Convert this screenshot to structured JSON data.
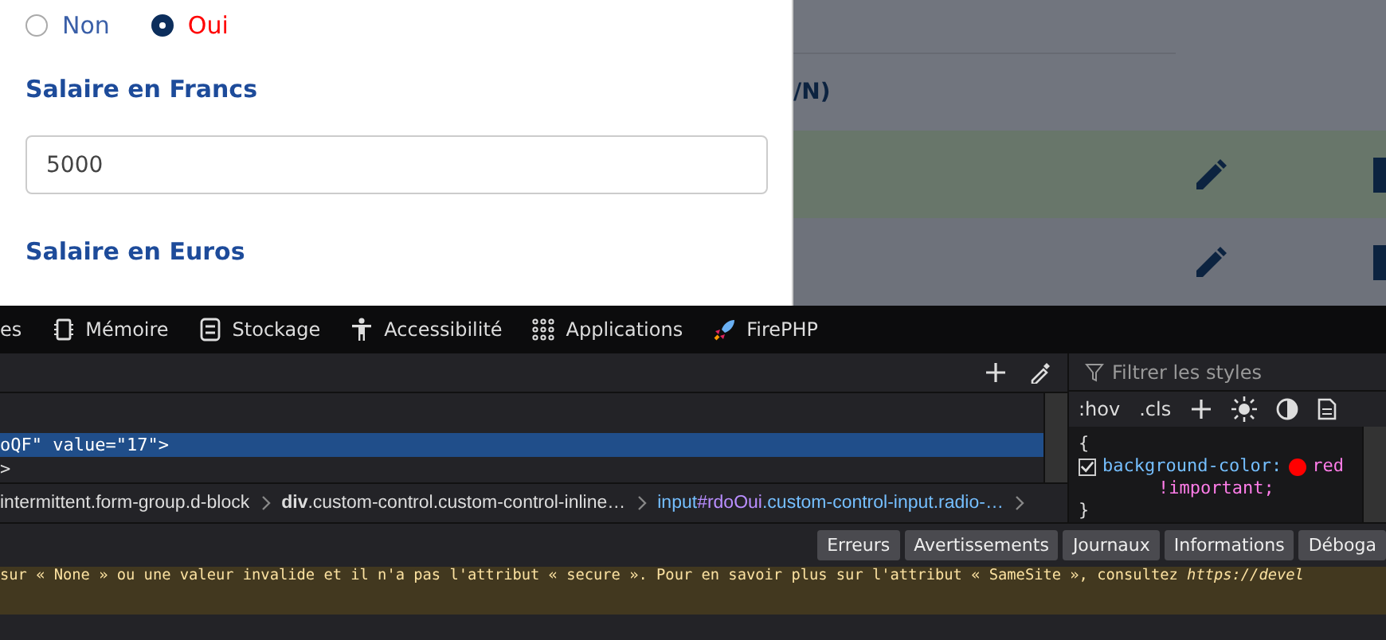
{
  "form": {
    "radios": [
      {
        "label": "Non",
        "selected": false
      },
      {
        "label": "Oui",
        "selected": true
      }
    ],
    "fields": [
      {
        "label": "Salaire en Francs",
        "value": "5000"
      },
      {
        "label": "Salaire en Euros"
      }
    ]
  },
  "background_table": {
    "column_header": "/N)",
    "rows": [
      {
        "highlighted": true
      },
      {
        "highlighted": false
      }
    ]
  },
  "devtools": {
    "tabs": [
      {
        "label": "es",
        "kind": "none"
      },
      {
        "label": "Mémoire",
        "kind": "memory"
      },
      {
        "label": "Stockage",
        "kind": "storage"
      },
      {
        "label": "Accessibilité",
        "kind": "accessibility"
      },
      {
        "label": "Applications",
        "kind": "apps"
      },
      {
        "label": "FirePHP",
        "kind": "rocket"
      }
    ],
    "markup_lines": [
      {
        "text": "oQF\" value=\"17\">",
        "selected": true
      },
      {
        "text": ">",
        "selected": false
      }
    ],
    "breadcrumbs": [
      {
        "classes": "intermittent.form-group.d-block",
        "selected": false
      },
      {
        "tag": "div",
        "classes": ".custom-control.custom-control-inline…",
        "selected": false
      },
      {
        "tag": "input",
        "id": "#rdoOui",
        "classes": ".custom-control-input.radio-…",
        "selected": true
      }
    ],
    "rules": {
      "filter_placeholder": "Filtrer les styles",
      "buttons": [
        ":hov",
        ".cls"
      ],
      "open": "{",
      "declaration": {
        "checked": true,
        "property": "background-color:",
        "color": "#ff0000",
        "value": "red",
        "priority": "!important;"
      },
      "close": "}"
    },
    "console": {
      "filters": [
        "Erreurs",
        "Avertissements",
        "Journaux",
        "Informations",
        "Déboga"
      ],
      "message": "sur « None » ou une valeur invalide et il n'a pas l'attribut « secure ». Pour en savoir plus sur l'attribut « SameSite », consultez ",
      "link": "https://devel"
    }
  }
}
